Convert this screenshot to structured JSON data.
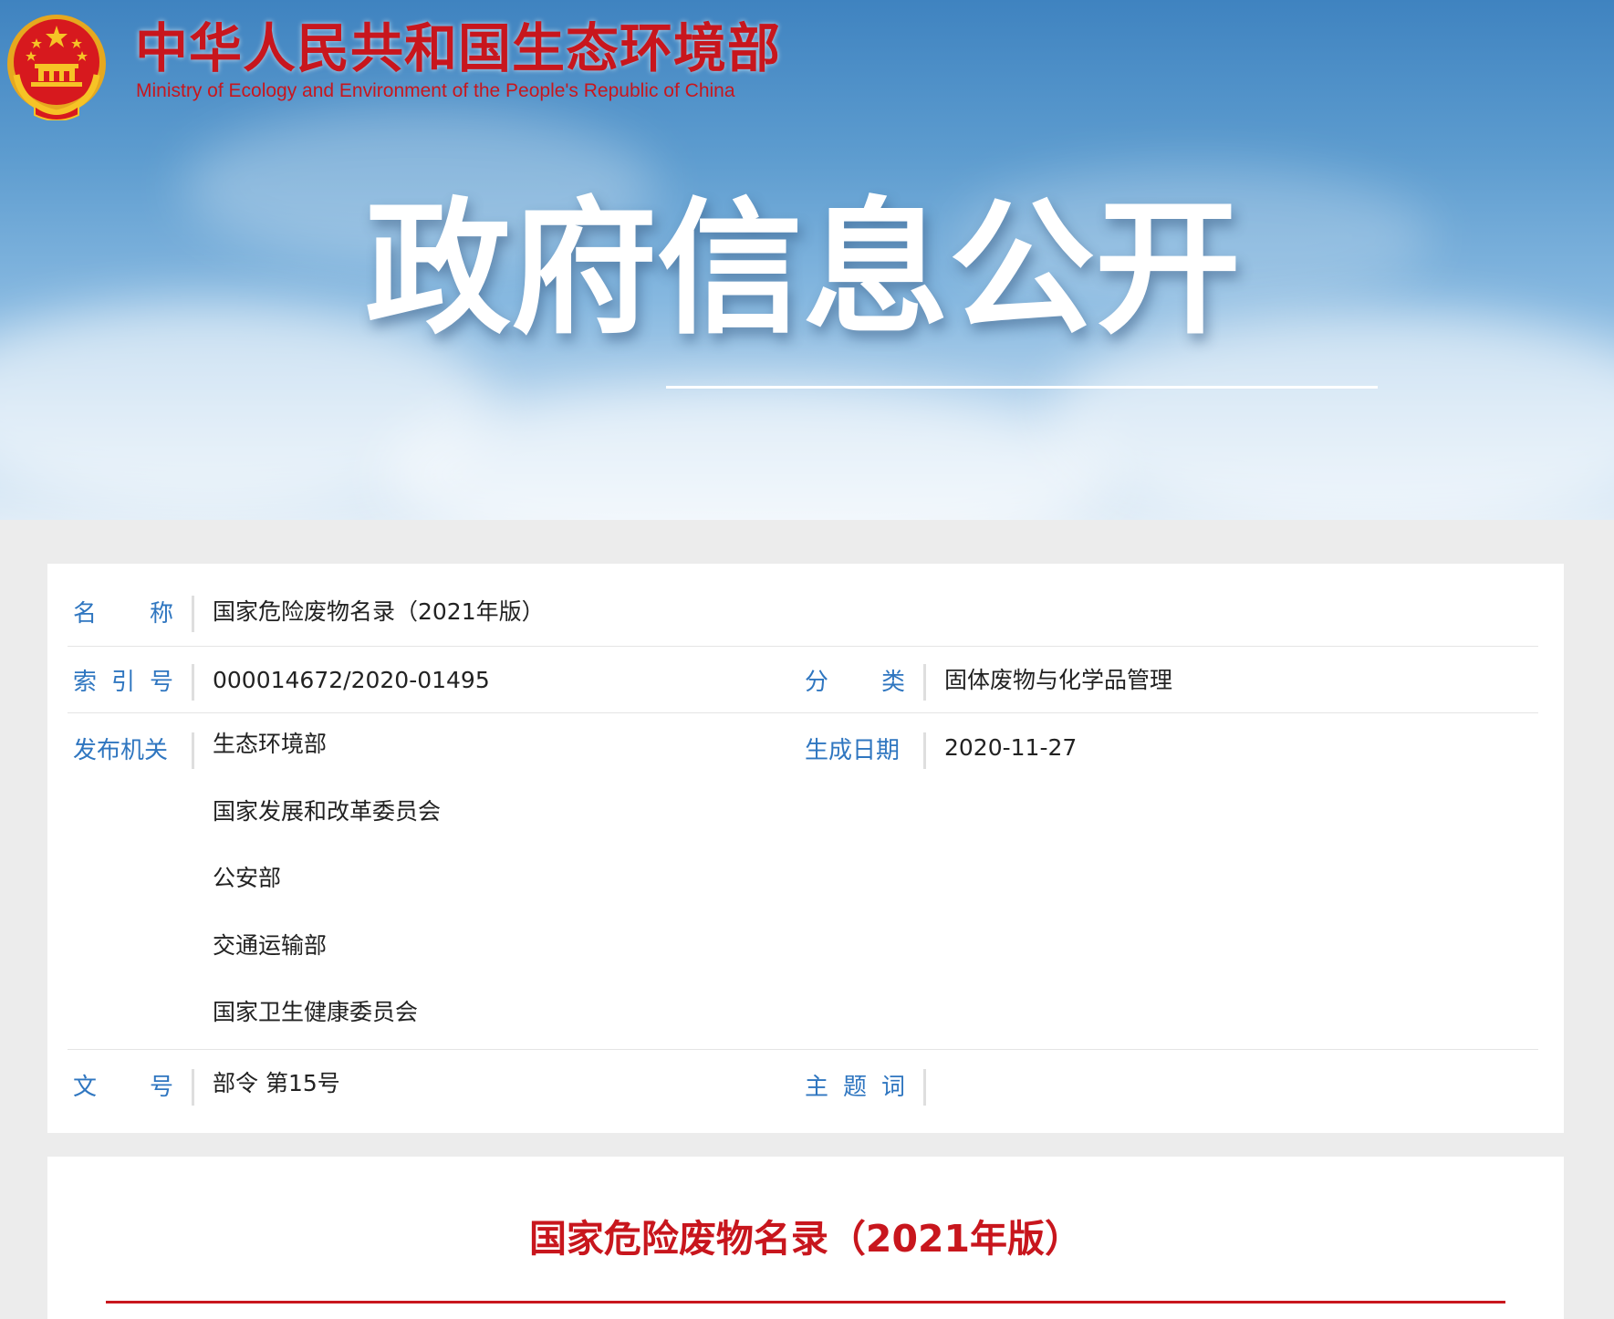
{
  "header": {
    "ministry_name_cn": "中华人民共和国生态环境部",
    "ministry_name_en": "Ministry of Ecology and Environment of the People's Republic of China",
    "banner_title": "政府信息公开",
    "emblem_icon": "national-emblem-icon"
  },
  "info": {
    "name_label": "名称",
    "name_value": "国家危险废物名录（2021年版）",
    "index_label": "索引号",
    "index_value": "000014672/2020-01495",
    "category_label": "分类",
    "category_value": "固体废物与化学品管理",
    "issuer_label": "发布机关",
    "issuers": [
      "生态环境部",
      "国家发展和改革委员会",
      "公安部",
      "交通运输部",
      "国家卫生健康委员会"
    ],
    "date_label": "生成日期",
    "date_value": "2020-11-27",
    "doc_no_label": "文号",
    "doc_no_value": "部令 第15号",
    "keywords_label": "主题词",
    "keywords_value": ""
  },
  "article": {
    "title": "国家危险废物名录（2021年版）"
  },
  "colors": {
    "brand_red": "#c8161d",
    "label_blue": "#2f76c0",
    "page_bg": "#ececec"
  }
}
